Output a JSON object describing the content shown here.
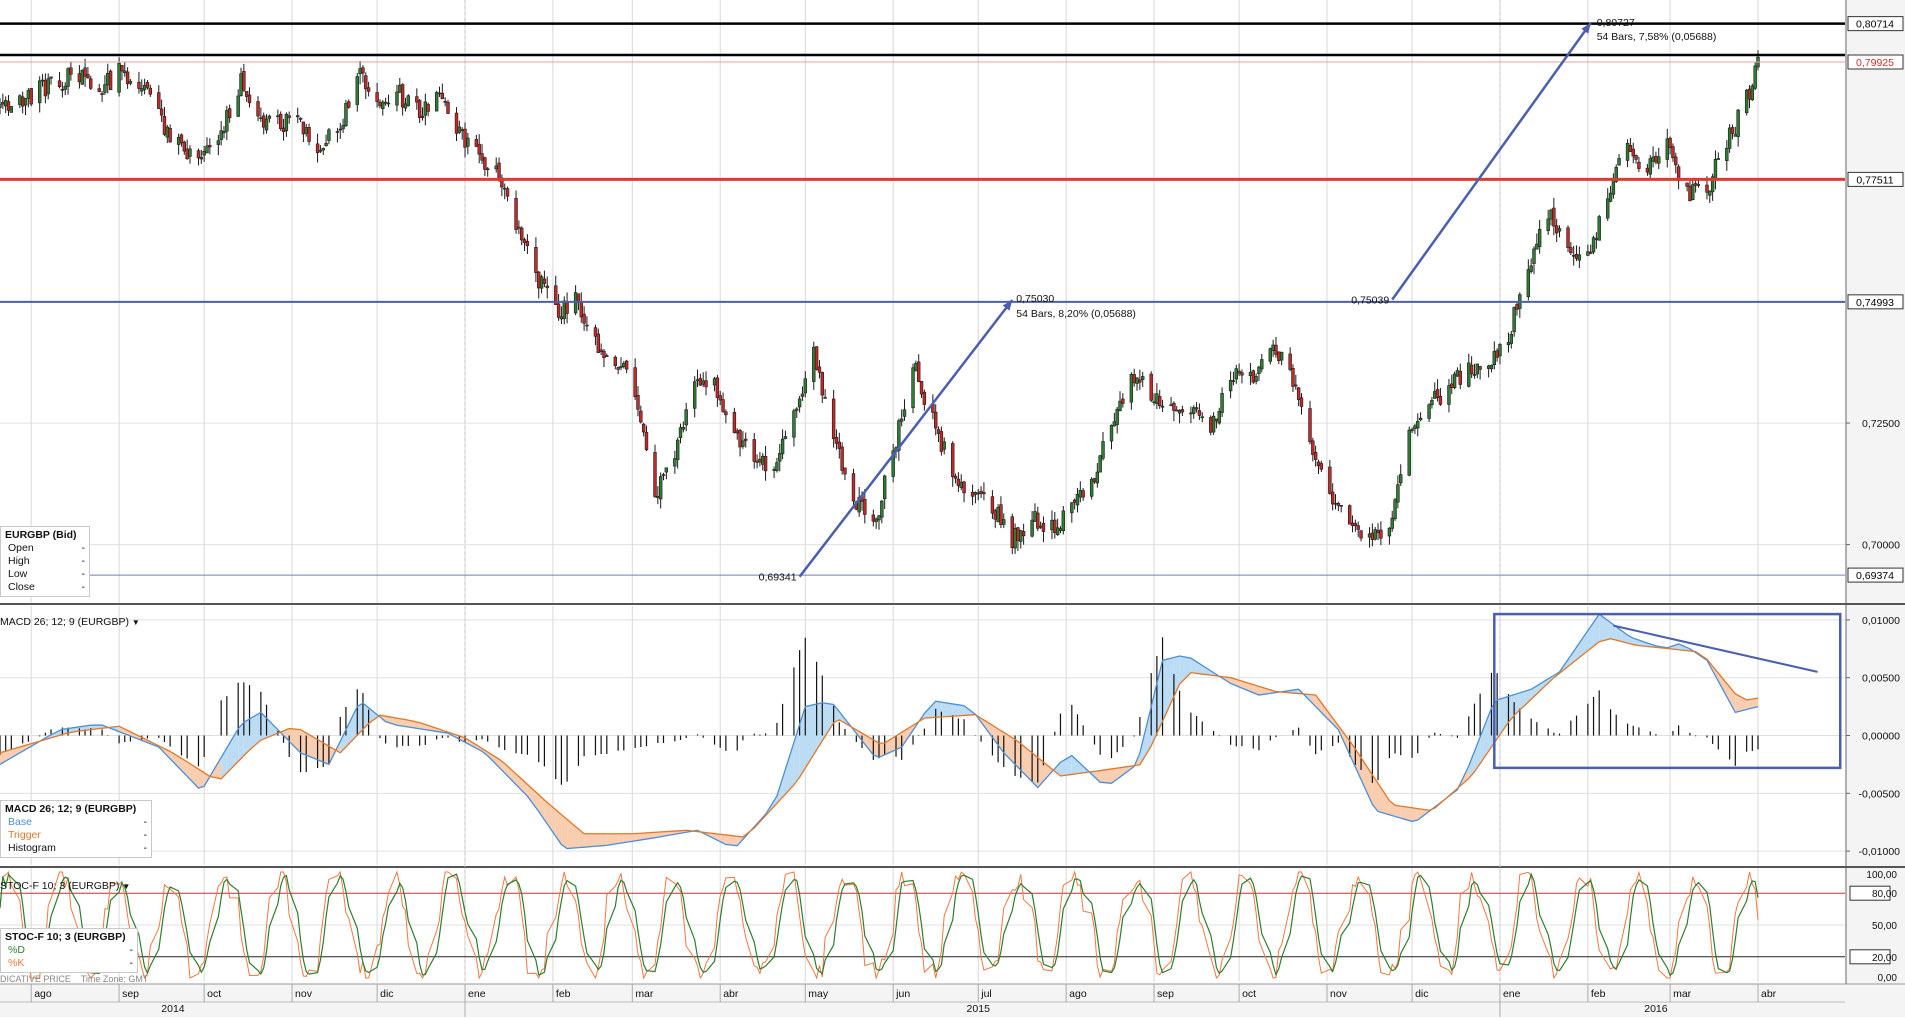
{
  "chart_data": [
    {
      "type": "candlestick",
      "pane": "price",
      "symbol_label": "EURGBP (Bid)",
      "legend_fields": [
        {
          "label": "Open",
          "value": "-"
        },
        {
          "label": "High",
          "value": "-"
        },
        {
          "label": "Low",
          "value": "-"
        },
        {
          "label": "Close",
          "value": "-"
        }
      ],
      "ylim": [
        0.688,
        0.812
      ],
      "y_ticks": [
        "0,70000",
        "0,72500"
      ],
      "price_tags": [
        {
          "text": "0,80714",
          "value": 0.80714,
          "color": "#000000"
        },
        {
          "text": "0,79925",
          "value": 0.79925,
          "color": "#d0302a"
        },
        {
          "text": "0,77511",
          "value": 0.77511,
          "color": "#000000"
        },
        {
          "text": "0,74993",
          "value": 0.74993,
          "color": "#000000"
        },
        {
          "text": "0,69374",
          "value": 0.69374,
          "color": "#000000"
        }
      ],
      "horizontal_lines": [
        {
          "value": 0.80714,
          "color": "#000000",
          "width": 2.5
        },
        {
          "value": 0.8007,
          "color": "#000000",
          "width": 2.5
        },
        {
          "value": 0.79925,
          "color": "#e9a0a0",
          "width": 1
        },
        {
          "value": 0.77511,
          "color": "#e03a30",
          "width": 3
        },
        {
          "value": 0.74993,
          "color": "#4a5fb0",
          "width": 2
        },
        {
          "value": 0.69374,
          "color": "#6f7dbf",
          "width": 1
        }
      ],
      "annotations": [
        {
          "text": "0,69341"
        },
        {
          "text": "0,75030"
        },
        {
          "text": "54 Bars, 8,20% (0,05688)"
        },
        {
          "text": "0,75039"
        },
        {
          "text": "0,80727"
        },
        {
          "text": "54 Bars, 7,58% (0,05688)"
        }
      ],
      "projection_arrows": [
        {
          "from": {
            "date": "2015-04-29",
            "value": 0.69341
          },
          "to": {
            "date": "2015-07-13",
            "value": 0.7503
          }
        },
        {
          "from": {
            "date": "2015-11-24",
            "value": 0.75039
          },
          "to": {
            "date": "2016-02-02",
            "value": 0.80727
          }
        }
      ],
      "close_anchors": [
        [
          "2014-07-21",
          0.7895
        ],
        [
          "2014-08-04",
          0.7935
        ],
        [
          "2014-08-18",
          0.797
        ],
        [
          "2014-08-25",
          0.7935
        ],
        [
          "2014-09-02",
          0.7975
        ],
        [
          "2014-09-09",
          0.795
        ],
        [
          "2014-09-16",
          0.7868
        ],
        [
          "2014-09-23",
          0.7812
        ],
        [
          "2014-09-30",
          0.778
        ],
        [
          "2014-10-07",
          0.7855
        ],
        [
          "2014-10-14",
          0.7955
        ],
        [
          "2014-10-21",
          0.788
        ],
        [
          "2014-11-04",
          0.786
        ],
        [
          "2014-11-11",
          0.7815
        ],
        [
          "2014-11-18",
          0.7865
        ],
        [
          "2014-11-25",
          0.7958
        ],
        [
          "2014-12-02",
          0.79
        ],
        [
          "2014-12-09",
          0.7925
        ],
        [
          "2014-12-16",
          0.789
        ],
        [
          "2014-12-23",
          0.7935
        ],
        [
          "2015-01-01",
          0.7825
        ],
        [
          "2015-01-05",
          0.78
        ],
        [
          "2015-01-12",
          0.7768
        ],
        [
          "2015-01-19",
          0.766
        ],
        [
          "2015-01-26",
          0.7555
        ],
        [
          "2015-02-02",
          0.7475
        ],
        [
          "2015-02-09",
          0.7512
        ],
        [
          "2015-02-16",
          0.741
        ],
        [
          "2015-02-23",
          0.738
        ],
        [
          "2015-03-02",
          0.7315
        ],
        [
          "2015-03-09",
          0.7105
        ],
        [
          "2015-03-16",
          0.7175
        ],
        [
          "2015-03-23",
          0.7335
        ],
        [
          "2015-03-30",
          0.7325
        ],
        [
          "2015-04-06",
          0.7235
        ],
        [
          "2015-04-13",
          0.718
        ],
        [
          "2015-04-20",
          0.7165
        ],
        [
          "2015-04-27",
          0.7268
        ],
        [
          "2015-05-04",
          0.7405
        ],
        [
          "2015-05-11",
          0.7215
        ],
        [
          "2015-05-18",
          0.7095
        ],
        [
          "2015-05-25",
          0.7035
        ],
        [
          "2015-06-01",
          0.7185
        ],
        [
          "2015-06-08",
          0.7375
        ],
        [
          "2015-06-15",
          0.7255
        ],
        [
          "2015-06-22",
          0.7142
        ],
        [
          "2015-06-29",
          0.7088
        ],
        [
          "2015-07-06",
          0.7082
        ],
        [
          "2015-07-13",
          0.7012
        ],
        [
          "2015-07-20",
          0.7052
        ],
        [
          "2015-07-27",
          0.7035
        ],
        [
          "2015-08-03",
          0.7068
        ],
        [
          "2015-08-10",
          0.7122
        ],
        [
          "2015-08-17",
          0.7252
        ],
        [
          "2015-08-24",
          0.7352
        ],
        [
          "2015-08-31",
          0.7315
        ],
        [
          "2015-09-07",
          0.7285
        ],
        [
          "2015-09-14",
          0.7272
        ],
        [
          "2015-09-21",
          0.7235
        ],
        [
          "2015-09-28",
          0.7355
        ],
        [
          "2015-10-05",
          0.7345
        ],
        [
          "2015-10-12",
          0.7405
        ],
        [
          "2015-10-19",
          0.7355
        ],
        [
          "2015-10-26",
          0.7215
        ],
        [
          "2015-11-02",
          0.7112
        ],
        [
          "2015-11-09",
          0.7045
        ],
        [
          "2015-11-16",
          0.7002
        ],
        [
          "2015-11-23",
          0.7035
        ],
        [
          "2015-11-30",
          0.7235
        ],
        [
          "2015-12-07",
          0.7285
        ],
        [
          "2015-12-14",
          0.7325
        ],
        [
          "2015-12-21",
          0.7355
        ],
        [
          "2015-12-28",
          0.7372
        ],
        [
          "2016-01-04",
          0.7435
        ],
        [
          "2016-01-11",
          0.7565
        ],
        [
          "2016-01-18",
          0.7685
        ],
        [
          "2016-01-25",
          0.7625
        ],
        [
          "2016-02-01",
          0.7582
        ],
        [
          "2016-02-08",
          0.7725
        ],
        [
          "2016-02-15",
          0.7815
        ],
        [
          "2016-02-22",
          0.7775
        ],
        [
          "2016-02-29",
          0.7825
        ],
        [
          "2016-03-07",
          0.7722
        ],
        [
          "2016-03-14",
          0.7735
        ],
        [
          "2016-03-21",
          0.7825
        ],
        [
          "2016-03-28",
          0.7915
        ],
        [
          "2016-04-01",
          0.7992
        ]
      ]
    },
    {
      "type": "line+histogram",
      "pane": "macd",
      "title": "MACD 26; 12; 9 (EURGBP)",
      "legend_box_title": "MACD 26; 12; 9 (EURGBP)",
      "series": [
        {
          "name": "Base",
          "color": "#4a8fd8"
        },
        {
          "name": "Trigger",
          "color": "#e0782a"
        },
        {
          "name": "Histogram",
          "color": "#000000"
        }
      ],
      "legend_values": [
        "-",
        "-",
        "-"
      ],
      "ylim": [
        -0.0112,
        0.0112
      ],
      "y_ticks": [
        "0,01000",
        "0,00500",
        "0,00000",
        "-0,00500",
        "-0,01000"
      ],
      "y_tick_values": [
        0.01,
        0.005,
        0.0,
        -0.005,
        -0.01
      ],
      "base_anchors": [
        [
          "2014-07-21",
          -0.0025
        ],
        [
          "2014-08-11",
          0.0005
        ],
        [
          "2014-08-25",
          0.001
        ],
        [
          "2014-09-15",
          -0.001
        ],
        [
          "2014-09-30",
          -0.0048
        ],
        [
          "2014-10-14",
          0.001
        ],
        [
          "2014-10-21",
          0.002
        ],
        [
          "2014-11-04",
          -0.0015
        ],
        [
          "2014-11-14",
          -0.0025
        ],
        [
          "2014-11-25",
          0.003
        ],
        [
          "2014-12-05",
          0.001
        ],
        [
          "2014-12-26",
          0.0002
        ],
        [
          "2015-01-08",
          -0.0015
        ],
        [
          "2015-01-24",
          -0.0055
        ],
        [
          "2015-02-05",
          -0.0098
        ],
        [
          "2015-02-20",
          -0.0095
        ],
        [
          "2015-03-10",
          -0.0088
        ],
        [
          "2015-03-24",
          -0.0082
        ],
        [
          "2015-04-06",
          -0.0098
        ],
        [
          "2015-04-20",
          -0.006
        ],
        [
          "2015-05-01",
          0.0025
        ],
        [
          "2015-05-10",
          0.003
        ],
        [
          "2015-05-26",
          -0.002
        ],
        [
          "2015-06-04",
          -0.001
        ],
        [
          "2015-06-15",
          0.003
        ],
        [
          "2015-06-28",
          0.0025
        ],
        [
          "2015-07-10",
          -0.0015
        ],
        [
          "2015-07-22",
          -0.0045
        ],
        [
          "2015-08-02",
          -0.0015
        ],
        [
          "2015-08-15",
          -0.0045
        ],
        [
          "2015-08-26",
          -0.0025
        ],
        [
          "2015-09-04",
          0.0065
        ],
        [
          "2015-09-12",
          0.007
        ],
        [
          "2015-09-28",
          0.0045
        ],
        [
          "2015-10-08",
          0.0035
        ],
        [
          "2015-10-22",
          0.004
        ],
        [
          "2015-11-05",
          0.0005
        ],
        [
          "2015-11-18",
          -0.0065
        ],
        [
          "2015-12-02",
          -0.0075
        ],
        [
          "2015-12-18",
          -0.0045
        ],
        [
          "2015-12-30",
          0.003
        ],
        [
          "2016-01-12",
          0.004
        ],
        [
          "2016-01-22",
          0.0055
        ],
        [
          "2016-02-05",
          0.0105
        ],
        [
          "2016-02-16",
          0.0085
        ],
        [
          "2016-02-28",
          0.0075
        ],
        [
          "2016-03-05",
          0.008
        ],
        [
          "2016-03-14",
          0.0065
        ],
        [
          "2016-03-24",
          0.002
        ],
        [
          "2016-04-01",
          0.0025
        ],
        [
          "2016-04-12",
          0.0045
        ],
        [
          "2016-04-22",
          0.0055
        ]
      ],
      "trigger_anchors": [
        [
          "2014-07-21",
          -0.0015
        ],
        [
          "2014-08-15",
          0.0003
        ],
        [
          "2014-09-01",
          0.0008
        ],
        [
          "2014-09-20",
          -0.0015
        ],
        [
          "2014-10-06",
          -0.004
        ],
        [
          "2014-10-20",
          -0.0005
        ],
        [
          "2014-11-02",
          0.0008
        ],
        [
          "2014-11-18",
          -0.0015
        ],
        [
          "2014-12-01",
          0.0018
        ],
        [
          "2014-12-15",
          0.0012
        ],
        [
          "2015-01-01",
          -0.0002
        ],
        [
          "2015-01-14",
          -0.0022
        ],
        [
          "2015-01-30",
          -0.0058
        ],
        [
          "2015-02-12",
          -0.0085
        ],
        [
          "2015-03-01",
          -0.0085
        ],
        [
          "2015-03-20",
          -0.0082
        ],
        [
          "2015-04-10",
          -0.0088
        ],
        [
          "2015-04-28",
          -0.004
        ],
        [
          "2015-05-12",
          0.0015
        ],
        [
          "2015-05-28",
          -0.0008
        ],
        [
          "2015-06-12",
          0.0015
        ],
        [
          "2015-06-30",
          0.0018
        ],
        [
          "2015-07-15",
          -0.0005
        ],
        [
          "2015-07-30",
          -0.0035
        ],
        [
          "2015-08-14",
          -0.003
        ],
        [
          "2015-08-28",
          -0.0025
        ],
        [
          "2015-09-12",
          0.0055
        ],
        [
          "2015-09-28",
          0.005
        ],
        [
          "2015-10-14",
          0.0038
        ],
        [
          "2015-10-28",
          0.0035
        ],
        [
          "2015-11-10",
          -0.0008
        ],
        [
          "2015-11-24",
          -0.006
        ],
        [
          "2015-12-08",
          -0.0065
        ],
        [
          "2015-12-22",
          -0.0035
        ],
        [
          "2016-01-05",
          0.0015
        ],
        [
          "2016-01-20",
          0.005
        ],
        [
          "2016-02-07",
          0.0085
        ],
        [
          "2016-02-18",
          0.0078
        ],
        [
          "2016-03-01",
          0.0075
        ],
        [
          "2016-03-12",
          0.0072
        ],
        [
          "2016-03-26",
          0.003
        ],
        [
          "2016-04-08",
          0.0035
        ],
        [
          "2016-04-22",
          0.0045
        ]
      ],
      "annotation_box": {
        "from": "2015-12-30",
        "to": "2016-04-30",
        "ymax": 0.0105,
        "ymin": -0.0028
      },
      "divergence_line": {
        "from": {
          "date": "2016-02-10",
          "value": 0.0095
        },
        "to": {
          "date": "2016-04-22",
          "value": 0.0055
        }
      }
    },
    {
      "type": "line",
      "pane": "stochastic",
      "title": "STOC-F 10; 3 (EURGBP)",
      "legend_box_title": "STOC-F 10; 3 (EURGBP)",
      "series": [
        {
          "name": "%D",
          "color": "#2e7d32"
        },
        {
          "name": "%K",
          "color": "#f07840"
        }
      ],
      "legend_values": [
        "-",
        "-"
      ],
      "ylim": [
        0,
        100
      ],
      "y_ticks": [
        "100,00",
        "80,00",
        "50,00",
        "20,00",
        "0,00"
      ],
      "y_tick_values": [
        100,
        80,
        50,
        20,
        0
      ],
      "levels": [
        {
          "value": 80,
          "color": "#d0302a",
          "text": "80,00"
        },
        {
          "value": 20,
          "color": "#222222",
          "text": "20,00"
        }
      ]
    }
  ],
  "time_axis": {
    "months": [
      {
        "label": "ago",
        "date": "2014-08-01"
      },
      {
        "label": "sep",
        "date": "2014-09-01"
      },
      {
        "label": "oct",
        "date": "2014-10-01"
      },
      {
        "label": "nov",
        "date": "2014-11-01"
      },
      {
        "label": "dic",
        "date": "2014-12-01"
      },
      {
        "label": "ene",
        "date": "2015-01-01"
      },
      {
        "label": "feb",
        "date": "2015-02-01"
      },
      {
        "label": "mar",
        "date": "2015-03-01"
      },
      {
        "label": "abr",
        "date": "2015-04-01"
      },
      {
        "label": "may",
        "date": "2015-05-01"
      },
      {
        "label": "jun",
        "date": "2015-06-01"
      },
      {
        "label": "jul",
        "date": "2015-07-01"
      },
      {
        "label": "ago",
        "date": "2015-08-01"
      },
      {
        "label": "sep",
        "date": "2015-09-01"
      },
      {
        "label": "oct",
        "date": "2015-10-01"
      },
      {
        "label": "nov",
        "date": "2015-11-01"
      },
      {
        "label": "dic",
        "date": "2015-12-01"
      },
      {
        "label": "ene",
        "date": "2016-01-01"
      },
      {
        "label": "feb",
        "date": "2016-02-01"
      },
      {
        "label": "mar",
        "date": "2016-03-01"
      },
      {
        "label": "abr",
        "date": "2016-04-01"
      }
    ],
    "years": [
      {
        "label": "2014",
        "date": "2014-09-20"
      },
      {
        "label": "2015",
        "date": "2015-07-01"
      },
      {
        "label": "2016",
        "date": "2016-02-25"
      }
    ],
    "year_breaks": [
      "2015-01-01",
      "2016-01-01"
    ]
  },
  "footer": {
    "price_type": "DICATIVE PRICE",
    "time_zone": "Time Zone: GMT"
  }
}
